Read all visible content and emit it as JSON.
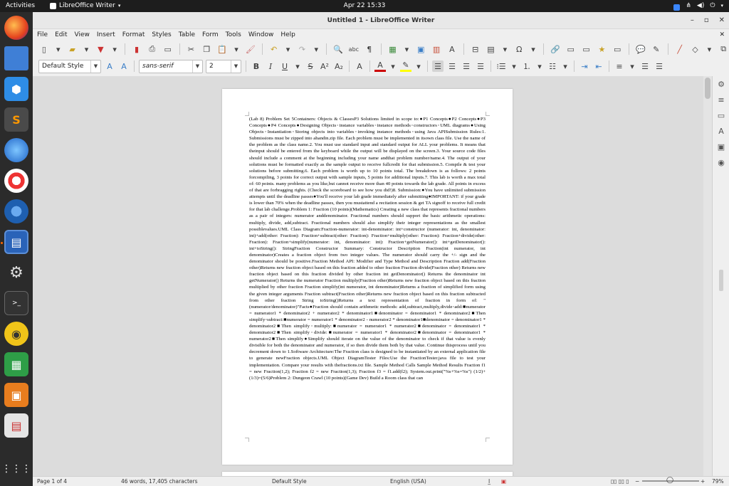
{
  "topbar": {
    "activities": "Activities",
    "app_menu": "LibreOffice Writer",
    "clock": "Apr 22  15:33"
  },
  "window": {
    "title": "Untitled 1 - LibreOffice Writer"
  },
  "menu": [
    "File",
    "Edit",
    "View",
    "Insert",
    "Format",
    "Styles",
    "Table",
    "Form",
    "Tools",
    "Window",
    "Help"
  ],
  "format_bar": {
    "paragraph_style": "Default Style",
    "font_name": "sans-serif",
    "font_size": "2"
  },
  "document": {
    "text": "(Lab 8) Problem Set 5Containers: Objects & ClassesP3 Solutions limited in scope to:●P1 Concepts●P2 Concepts●P3 Concepts●P4 Concepts●Designing Objects◦instance variables◦instance methods◦constructors◦UML diagrams●Using Objects◦Instantiation◦Storing objects into variables◦invoking instance methods◦using Java APISubmission Rules:1. Submissions must be zipped into ahandin.zip file. Each problem must be implemented in itsown class file. Use the name of the problem as the class name.2. You must use standard input and standard output for ALL your problems. It means that theinput should be entered from the keyboard while the output will be displayed on the screen.3. Your source code files should include a comment at the beginning including your name andthat problem number/name.4. The output of your solutions must be formatted exactly as the sample output to receive fullcredit for that submission.5. Compile & test your solutions before submitting.6. Each problem is worth up to 10 points total. The breakdown is as follows: 2 points forcompiling, 3 points for correct output with sample inputs, 5 points for additional inputs.7. This lab is worth a max total of: 60 points. many problems as you like,but cannot receive more than 40 points towards the lab grade. All points in excess of that are forbragging rights. (Check the scoreboard to see how you did!)8. Submission:●You have unlimited submission attempts until the deadline passes●You'll receive your lab grade immediately after submitting●IMPORTANT: if your grade is lower than 70% when the deadline passes, then you mustattend a recitation session & get TA signoff to receive full credit for that lab challenge.Problem 1: Fraction (10 points)(Mathematics) Creating a new class that represents fractional numbers as a pair of integers: numerator anddenominator. Fractional numbers should support the basic arithmetic operations: multiply, divide, add,subtract. Fractional numbers should also simplify their integer representations as the smallest possiblevalues.UML Class Diagram:Fraction-numerator: int-denominator: int+constructor (numerator: int, denominator: int)+add(other: Fraction): Fraction+subtract(other: Fraction): Fraction+multiply(other: Fraction): Fraction+divide(other: Fraction): Fraction+simplify(numerator: int, denominator: int): Fraction+getNumerator(): int+getDenominator(): int+toString(): StringFraction Constructor Summary: Constructor Description Fraction(int numerator, int denominator)Creates a fraction object from two integer values. The numerator should carry the +/- sign and the denominator should be positive.Fraction Method API: Modifier and Type Method and Description Fraction add(Fraction other)Returns new fraction object based on this fraction added to other fraction Fraction divide(Fraction other) Returns new fraction object based on this fraction divided by other fraction int getDenominator() Returns the denominator int getNumerator() Returns the numerator Fraction multiply(Fraction other)Returns new fraction object based on this fraction multiplied by other fraction Fraction simplify(int numerator, int denominator)Returns a fraction of simplified form using the given integer arguments Fraction subtract(Fraction other)Returns new fraction object based on this fraction subtracted from other fraction String toString()Returns a text representation of fraction in form of: \"(numerator/denominator)\"Facts●Fraction should contain arithmetic methods: add,subtract,multiply,divide◦add:■numerator = numerator1 * denominator2 + numerator2 * denominator1■denominator = denominator1 * denominator2■Then simplify◦subtract:■numerator = numerator1 * denominator2 - numerator2 * denominator1■denominator = denominator1 * denominator2■Then simplify◦multiply:■numerator = numerator1 * numerator2■denominator = denominator1 * denominator2■Then simplify◦divide:■numerator = numerator1 * denominator2■denominator = denominator1 * numerator2■Then simplify●Simplify should iterate on the value of the denominator to check if that value is evenly divisible for both the denominator and numerator, if so then divide them both by that value. Continue thisprocess until you decrement down to 1.Software Architecture:The Fraction class is designed to be instantiated by an external application file to generate newFraction objects.UML Object DiagramTester Files:Use the FractionTester.java file to test your implementation. Compare your results with thefractions.txt file. Sample Method Calls Sample Method Results Fraction f1 = new Fraction(1,2); Fraction f2 = new Fraction(1,3); Fraction f3 = f1.add(f2); System.out.print(\"%s+%s=%s\") (1/2)+(1/3)=(5/6)Problem 2: Dungeon Crawl (10 points)(Game Dev) Build a Room class that can"
  },
  "status": {
    "page": "Page 1 of 4",
    "words": "46 words, 17,405 characters",
    "page_style": "Default Style",
    "language": "English (USA)",
    "zoom": "79%"
  }
}
